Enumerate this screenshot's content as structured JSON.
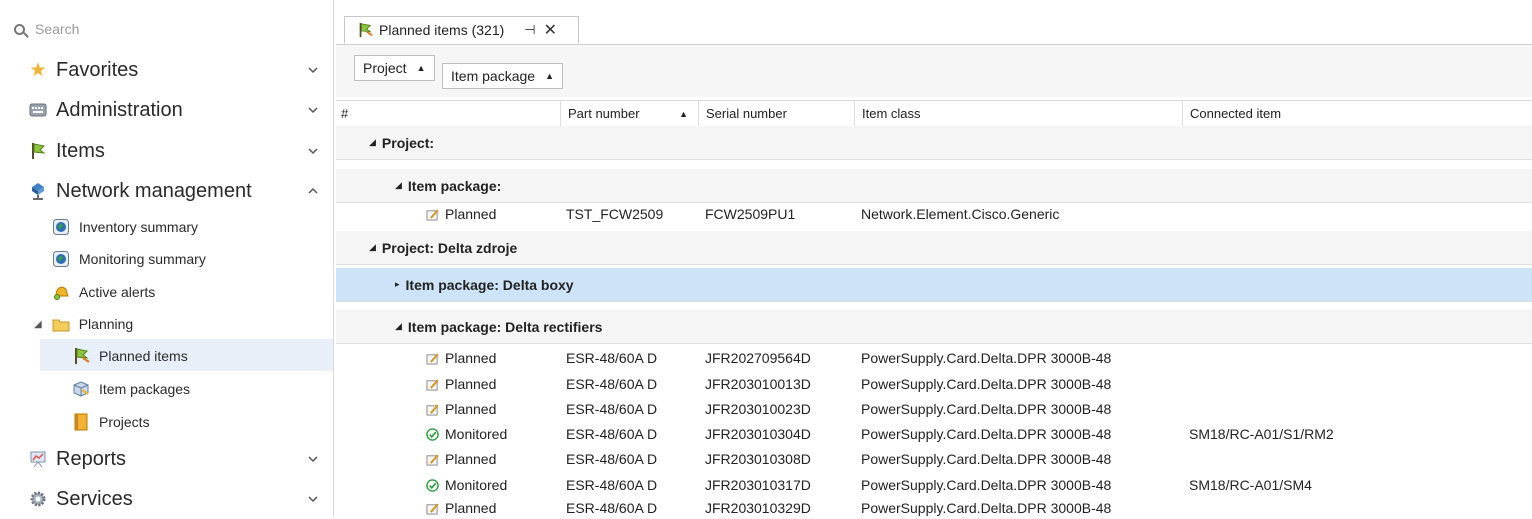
{
  "sidebar": {
    "search_placeholder": "Search",
    "items": [
      {
        "label": "Favorites",
        "icon": "star-icon"
      },
      {
        "label": "Administration",
        "icon": "keyboard-icon"
      },
      {
        "label": "Items",
        "icon": "flag-icon"
      },
      {
        "label": "Network management",
        "icon": "network-icon"
      },
      {
        "label": "Reports",
        "icon": "report-icon"
      },
      {
        "label": "Services",
        "icon": "gear-icon"
      }
    ],
    "sub_items": [
      {
        "label": "Inventory summary",
        "icon": "globe-icon"
      },
      {
        "label": "Monitoring summary",
        "icon": "globe-icon"
      },
      {
        "label": "Active alerts",
        "icon": "bell-icon"
      },
      {
        "label": "Planning",
        "icon": "folder-icon"
      },
      {
        "label": "Planned items",
        "icon": "planned-items-icon"
      },
      {
        "label": "Item packages",
        "icon": "package-icon"
      },
      {
        "label": "Projects",
        "icon": "book-icon"
      }
    ]
  },
  "tab": {
    "title": "Planned items (321)",
    "pin": "⊣",
    "close": "✕"
  },
  "grouping": {
    "chips": [
      "Project",
      "Item package"
    ]
  },
  "columns": [
    "#",
    "Part number",
    "Serial number",
    "Item class",
    "Connected item"
  ],
  "groups": {
    "g1": "Project:",
    "g2": "Item package:",
    "g3": "Project: Delta zdroje",
    "g4": "Item package: Delta boxy",
    "g5": "Item package: Delta rectifiers"
  },
  "rows": [
    {
      "status": "Planned",
      "part": "TST_FCW2509",
      "serial": "FCW2509PU1",
      "class": "Network.Element.Cisco.Generic",
      "connected": ""
    },
    {
      "status": "Planned",
      "part": "ESR-48/60A D",
      "serial": "JFR202709564D",
      "class": "PowerSupply.Card.Delta.DPR 3000B-48",
      "connected": ""
    },
    {
      "status": "Planned",
      "part": "ESR-48/60A D",
      "serial": "JFR203010013D",
      "class": "PowerSupply.Card.Delta.DPR 3000B-48",
      "connected": ""
    },
    {
      "status": "Planned",
      "part": "ESR-48/60A D",
      "serial": "JFR203010023D",
      "class": "PowerSupply.Card.Delta.DPR 3000B-48",
      "connected": ""
    },
    {
      "status": "Monitored",
      "part": "ESR-48/60A D",
      "serial": "JFR203010304D",
      "class": "PowerSupply.Card.Delta.DPR 3000B-48",
      "connected": "SM18/RC-A01/S1/RM2"
    },
    {
      "status": "Planned",
      "part": "ESR-48/60A D",
      "serial": "JFR203010308D",
      "class": "PowerSupply.Card.Delta.DPR 3000B-48",
      "connected": ""
    },
    {
      "status": "Monitored",
      "part": "ESR-48/60A D",
      "serial": "JFR203010317D",
      "class": "PowerSupply.Card.Delta.DPR 3000B-48",
      "connected": "SM18/RC-A01/SM4"
    },
    {
      "status": "Planned",
      "part": "ESR-48/60A D",
      "serial": "JFR203010329D",
      "class": "PowerSupply.Card.Delta.DPR 3000B-48",
      "connected": ""
    }
  ],
  "colors": {
    "selected_row": "#cde3f7",
    "sidebar_selected": "#e8eff8",
    "monitored_green": "#2f9a3e"
  }
}
